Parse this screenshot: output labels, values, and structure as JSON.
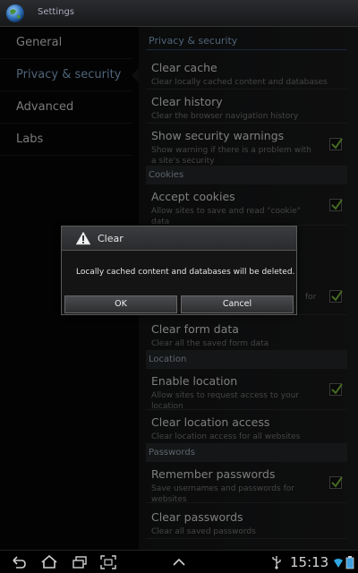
{
  "app": {
    "title": "Settings"
  },
  "nav": {
    "items": [
      {
        "label": "General"
      },
      {
        "label": "Privacy & security"
      },
      {
        "label": "Advanced"
      },
      {
        "label": "Labs"
      }
    ],
    "selected": "Privacy & security"
  },
  "content": {
    "header": "Privacy & security",
    "clear_cache": {
      "title": "Clear cache",
      "summary": "Clear locally cached content and databases"
    },
    "clear_history": {
      "title": "Clear history",
      "summary": "Clear the browser navigation history"
    },
    "security_warnings": {
      "title": "Show security warnings",
      "summary": "Show warning if there is a problem with a site's security",
      "checked": true
    },
    "cookies_header": "Cookies",
    "accept_cookies": {
      "title": "Accept cookies",
      "summary": "Allow sites to save and read \"cookie\" data",
      "checked": true
    },
    "clear_form": {
      "title": "Clear form data",
      "summary": "Clear all the saved form data"
    },
    "location_header": "Location",
    "enable_location": {
      "title": "Enable location",
      "summary": "Allow sites to request access to your location",
      "checked": true
    },
    "clear_location": {
      "title": "Clear location access",
      "summary": "Clear location access for all websites"
    },
    "passwords_header": "Passwords",
    "remember_passwords": {
      "title": "Remember passwords",
      "summary": "Save usernames and passwords for websites",
      "checked": true
    },
    "clear_passwords": {
      "title": "Clear passwords",
      "summary": "Clear all saved passwords"
    },
    "partial_row": {
      "summary_fragment": "for",
      "checked": true
    }
  },
  "dialog": {
    "title": "Clear",
    "message": "Locally cached content and databases will be deleted.",
    "ok_label": "OK",
    "cancel_label": "Cancel"
  },
  "status_bar": {
    "time": "15:13",
    "icons": [
      "back-icon",
      "home-icon",
      "recent-apps-icon",
      "screenshot-icon",
      "up-arrow-icon",
      "usb-icon",
      "wifi-icon",
      "battery-icon"
    ]
  },
  "colors": {
    "accent": "#8fb4da",
    "check": "#7fbf3f"
  }
}
